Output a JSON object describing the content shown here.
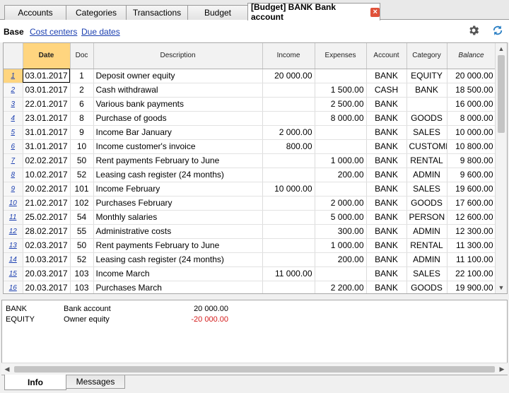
{
  "tabs": [
    {
      "label": "Accounts"
    },
    {
      "label": "Categories"
    },
    {
      "label": "Transactions"
    },
    {
      "label": "Budget"
    },
    {
      "label": "[Budget] BANK Bank account"
    }
  ],
  "close_glyph": "×",
  "subnav": {
    "base": "Base",
    "cost_centers": "Cost centers",
    "due_dates": "Due dates"
  },
  "icons": {
    "settings": "gear-icon",
    "refresh": "refresh-icon"
  },
  "table": {
    "columns": [
      "",
      "Date",
      "Doc",
      "Description",
      "Income",
      "Expenses",
      "Account",
      "Category",
      "Balance"
    ],
    "rows": [
      {
        "n": "1",
        "date": "03.01.2017",
        "doc": "1",
        "desc": "Deposit owner equity",
        "income": "20 000.00",
        "exp": "",
        "acc": "BANK",
        "cat": "EQUITY",
        "bal": "20 000.00"
      },
      {
        "n": "2",
        "date": "03.01.2017",
        "doc": "2",
        "desc": "Cash withdrawal",
        "income": "",
        "exp": "1 500.00",
        "acc": "CASH",
        "cat": "BANK",
        "bal": "18 500.00"
      },
      {
        "n": "3",
        "date": "22.01.2017",
        "doc": "6",
        "desc": "Various bank payments",
        "income": "",
        "exp": "2 500.00",
        "acc": "BANK",
        "cat": "",
        "bal": "16 000.00"
      },
      {
        "n": "4",
        "date": "23.01.2017",
        "doc": "8",
        "desc": "Purchase of goods",
        "income": "",
        "exp": "8 000.00",
        "acc": "BANK",
        "cat": "GOODS",
        "bal": "8 000.00"
      },
      {
        "n": "5",
        "date": "31.01.2017",
        "doc": "9",
        "desc": "Income Bar January",
        "income": "2 000.00",
        "exp": "",
        "acc": "BANK",
        "cat": "SALES",
        "bal": "10 000.00"
      },
      {
        "n": "6",
        "date": "31.01.2017",
        "doc": "10",
        "desc": "Income customer's invoice",
        "income": "800.00",
        "exp": "",
        "acc": "BANK",
        "cat": "CUSTOME",
        "bal": "10 800.00"
      },
      {
        "n": "7",
        "date": "02.02.2017",
        "doc": "50",
        "desc": "Rent payments February to June",
        "income": "",
        "exp": "1 000.00",
        "acc": "BANK",
        "cat": "RENTAL",
        "bal": "9 800.00"
      },
      {
        "n": "8",
        "date": "10.02.2017",
        "doc": "52",
        "desc": "Leasing cash register (24 months)",
        "income": "",
        "exp": "200.00",
        "acc": "BANK",
        "cat": "ADMIN",
        "bal": "9 600.00"
      },
      {
        "n": "9",
        "date": "20.02.2017",
        "doc": "101",
        "desc": "Income February",
        "income": "10 000.00",
        "exp": "",
        "acc": "BANK",
        "cat": "SALES",
        "bal": "19 600.00"
      },
      {
        "n": "10",
        "date": "21.02.2017",
        "doc": "102",
        "desc": "Purchases February",
        "income": "",
        "exp": "2 000.00",
        "acc": "BANK",
        "cat": "GOODS",
        "bal": "17 600.00"
      },
      {
        "n": "11",
        "date": "25.02.2017",
        "doc": "54",
        "desc": "Monthly salaries",
        "income": "",
        "exp": "5 000.00",
        "acc": "BANK",
        "cat": "PERSON",
        "bal": "12 600.00"
      },
      {
        "n": "12",
        "date": "28.02.2017",
        "doc": "55",
        "desc": "Administrative costs",
        "income": "",
        "exp": "300.00",
        "acc": "BANK",
        "cat": "ADMIN",
        "bal": "12 300.00"
      },
      {
        "n": "13",
        "date": "02.03.2017",
        "doc": "50",
        "desc": "Rent payments February to June",
        "income": "",
        "exp": "1 000.00",
        "acc": "BANK",
        "cat": "RENTAL",
        "bal": "11 300.00"
      },
      {
        "n": "14",
        "date": "10.03.2017",
        "doc": "52",
        "desc": "Leasing cash register (24 months)",
        "income": "",
        "exp": "200.00",
        "acc": "BANK",
        "cat": "ADMIN",
        "bal": "11 100.00"
      },
      {
        "n": "15",
        "date": "20.03.2017",
        "doc": "103",
        "desc": "Income March",
        "income": "11 000.00",
        "exp": "",
        "acc": "BANK",
        "cat": "SALES",
        "bal": "22 100.00"
      },
      {
        "n": "16",
        "date": "20.03.2017",
        "doc": "103",
        "desc": "Purchases March",
        "income": "",
        "exp": "2 200.00",
        "acc": "BANK",
        "cat": "GOODS",
        "bal": "19 900.00"
      }
    ]
  },
  "info": [
    {
      "account": "BANK",
      "description": "Bank account",
      "amount": "20 000.00",
      "negative": false
    },
    {
      "account": "EQUITY",
      "description": "Owner equity",
      "amount": "-20 000.00",
      "negative": true
    }
  ],
  "bottom_tabs": [
    {
      "label": "Info"
    },
    {
      "label": "Messages"
    }
  ],
  "colors": {
    "accent": "#ffd57f",
    "link": "#1b3fb0",
    "negative": "#d41a1a",
    "close": "#e0523a"
  }
}
